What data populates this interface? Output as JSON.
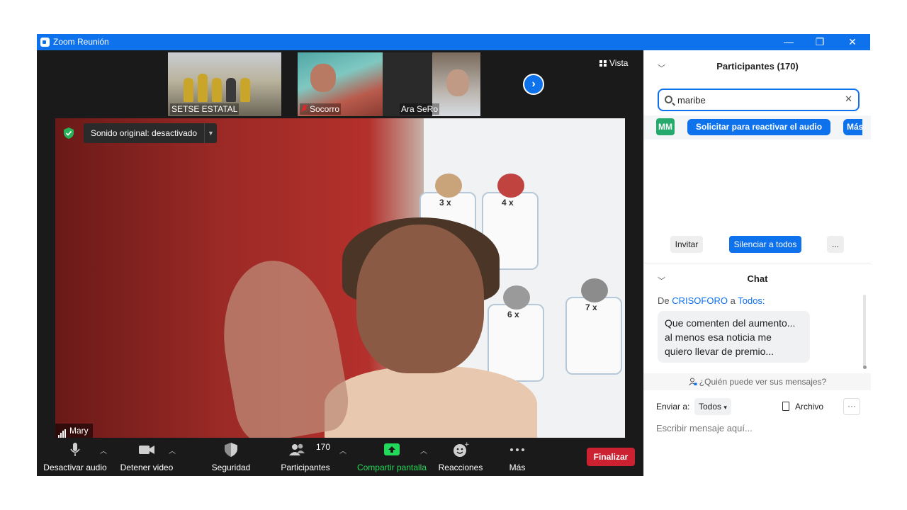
{
  "window": {
    "title": "Zoom Reunión",
    "controls": {
      "minimize": "—",
      "restore": "❐",
      "close": "✕"
    }
  },
  "gallery": {
    "thumbnails": [
      {
        "name": "SETSE ESTATAL",
        "muted": false
      },
      {
        "name": "Socorro",
        "muted": true
      },
      {
        "name": "Ara SeRo",
        "muted": false
      }
    ],
    "next_icon": "chevron-right-icon",
    "view_label": "Vista"
  },
  "main_video": {
    "speaker_name": "Mary",
    "original_sound_label": "Sonido original: desactivado",
    "poster_labels": [
      "4 x",
      "3 x",
      "6 x",
      "7 x"
    ]
  },
  "toolbar": {
    "mute_label": "Desactivar audio",
    "video_label": "Detener video",
    "security_label": "Seguridad",
    "participants_label": "Participantes",
    "participants_count": "170",
    "share_label": "Compartir pantalla",
    "reactions_label": "Reacciones",
    "more_label": "Más",
    "end_label": "Finalizar",
    "share_color": "#23d959",
    "end_color": "#cb2130"
  },
  "participants_panel": {
    "title": "Participantes (170)",
    "search_value": "maribe",
    "search_clear_icon": "close-icon",
    "result": {
      "initials": "MM",
      "avatar_color": "#26a96c",
      "request_unmute_label": "Solicitar para reactivar el audio",
      "more_label": "Más"
    },
    "invite_label": "Invitar",
    "mute_all_label": "Silenciar a todos",
    "more_label": "..."
  },
  "chat_panel": {
    "title": "Chat",
    "message": {
      "from_prefix": "De",
      "sender": "CRISOFORO",
      "to_prefix": "a",
      "recipient": "Todos:",
      "lines": [
        "Que comenten del aumento...",
        "al menos esa noticia me",
        "quiero llevar de premio..."
      ]
    },
    "who_can_see": "¿Quién puede ver sus mensajes?",
    "send_to_label": "Enviar a:",
    "send_to_value": "Todos",
    "file_label": "Archivo",
    "more_label": "···",
    "input_placeholder": "Escribir mensaje aquí..."
  },
  "colors": {
    "brand_blue": "#0e72ed",
    "meeting_bg": "#1a1a1a"
  }
}
